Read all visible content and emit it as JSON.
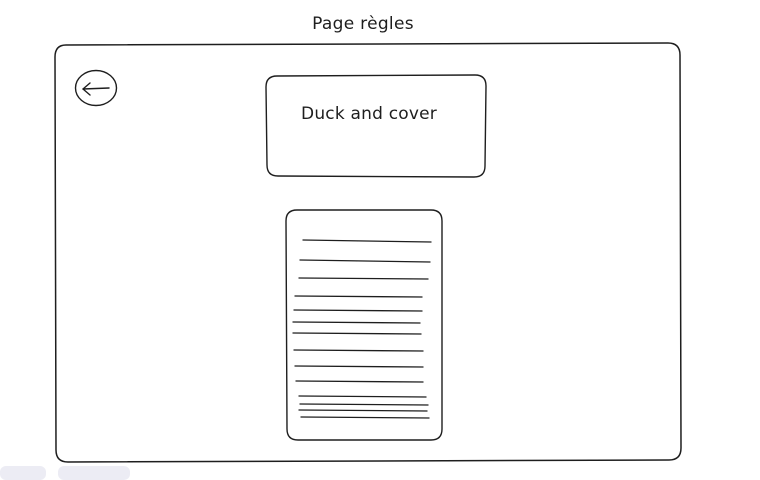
{
  "header": {
    "title": "Page règles"
  },
  "title_card": {
    "label": "Duck and cover"
  },
  "back_button": {
    "icon": "arrow-left-icon"
  },
  "rules_document": {
    "icon": "text-lines-placeholder",
    "line_count": 14
  },
  "colors": {
    "stroke": "#1e1e1e",
    "background": "#ffffff",
    "tab_stub": "#ececf4"
  }
}
